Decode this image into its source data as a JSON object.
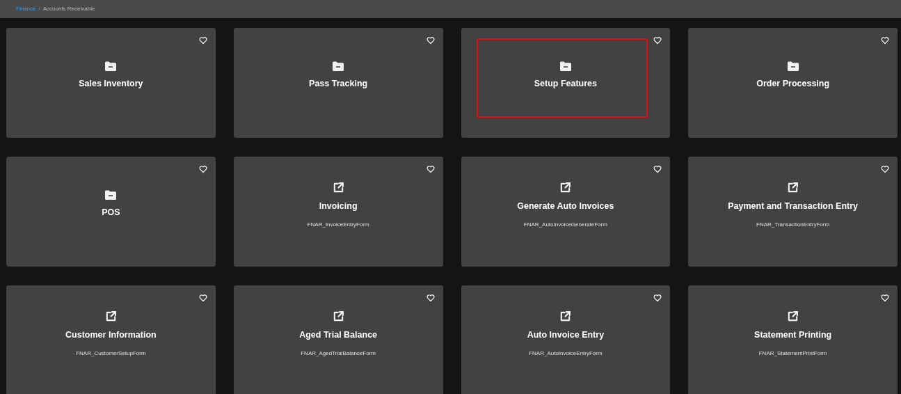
{
  "breadcrumb": {
    "parent": "Finance",
    "separator": "/",
    "current": "Accounts Receivable"
  },
  "cards": [
    {
      "kind": "folder",
      "title": "Sales Inventory",
      "highlighted": false
    },
    {
      "kind": "folder",
      "title": "Pass Tracking",
      "highlighted": false
    },
    {
      "kind": "folder",
      "title": "Setup Features",
      "highlighted": true
    },
    {
      "kind": "folder",
      "title": "Order Processing",
      "highlighted": false
    },
    {
      "kind": "folder",
      "title": "POS",
      "highlighted": false
    },
    {
      "kind": "form",
      "title": "Invoicing",
      "form": "FNAR_InvoiceEntryForm",
      "highlighted": false
    },
    {
      "kind": "form",
      "title": "Generate Auto Invoices",
      "form": "FNAR_AutoInvoiceGenerateForm",
      "highlighted": false
    },
    {
      "kind": "form",
      "title": "Payment and Transaction Entry",
      "form": "FNAR_TransactionEntryForm",
      "highlighted": false
    },
    {
      "kind": "form",
      "title": "Customer Information",
      "form": "FNAR_CustomerSetupForm",
      "highlighted": false
    },
    {
      "kind": "form",
      "title": "Aged Trial Balance",
      "form": "FNAR_AgedTrialBalanceForm",
      "highlighted": false
    },
    {
      "kind": "form",
      "title": "Auto Invoice Entry",
      "form": "FNAR_AutoInvoiceEntryForm",
      "highlighted": false
    },
    {
      "kind": "form",
      "title": "Statement Printing",
      "form": "FNAR_StatementPrintForm",
      "highlighted": false
    }
  ]
}
